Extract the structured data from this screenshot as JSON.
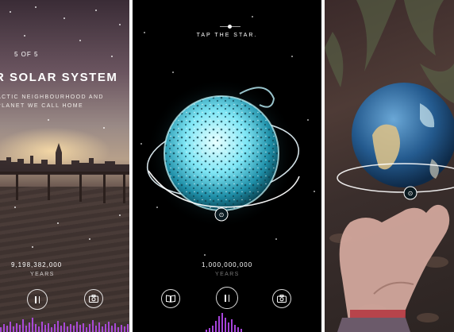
{
  "screens": {
    "left": {
      "counter": "5 OF 5",
      "title": "R SOLAR SYSTEM",
      "subtitle_line1": "ACTIC NEIGHBOURHOOD AND",
      "subtitle_line2": "PLANET WE CALL HOME",
      "years_value": "9,198,382,000",
      "years_label": "YEARS",
      "pause_icon": "pause-icon",
      "camera_icon": "camera-icon"
    },
    "middle": {
      "instruction": "TAP THE STAR.",
      "years_value": "1,000,000,000",
      "years_label": "YEARS",
      "book_icon": "book-icon",
      "pause_icon": "pause-icon",
      "camera_icon": "camera-icon",
      "star_color": "#9ff2ff"
    },
    "right": {
      "planet_icon": "info-icon",
      "ring_color": "#ffffff"
    }
  },
  "colors": {
    "waveform": "#c24fff",
    "text": "#ffffff"
  }
}
